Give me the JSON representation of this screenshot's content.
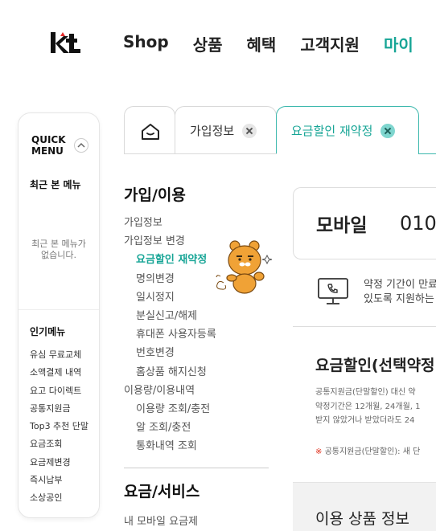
{
  "header": {
    "logo_text": "kt",
    "nav": [
      {
        "label": "Shop",
        "active": false
      },
      {
        "label": "상품",
        "active": false
      },
      {
        "label": "혜택",
        "active": false
      },
      {
        "label": "고객지원",
        "active": false
      },
      {
        "label": "마이",
        "active": true
      }
    ]
  },
  "quick_menu": {
    "title": "QUICK\nMENU",
    "recent_title": "최근 본 메뉴",
    "recent_empty": "최근 본 메뉴가\n없습니다.",
    "popular_title": "인기메뉴",
    "popular_items": [
      "유심 무료교체",
      "소액결제 내역",
      "요고 다이렉트",
      "공통지원금",
      "Top3 추천 단말",
      "요금조회",
      "요금제변경",
      "즉시납부",
      "소상공인"
    ]
  },
  "tabs": [
    {
      "label": "가입정보"
    },
    {
      "label": "요금할인 재약정",
      "active": true
    }
  ],
  "lnb": {
    "section1_title": "가입/이용",
    "items": [
      {
        "label": "가입정보",
        "level": 1
      },
      {
        "label": "가입정보 변경",
        "level": 1
      },
      {
        "label": "요금할인 재약정",
        "level": 2,
        "active": true
      },
      {
        "label": "명의변경",
        "level": 2
      },
      {
        "label": "일시정지",
        "level": 2
      },
      {
        "label": "분실신고/해제",
        "level": 2
      },
      {
        "label": "휴대폰 사용자등록",
        "level": 2
      },
      {
        "label": "번호변경",
        "level": 2
      },
      {
        "label": "홈상품 해지신청",
        "level": 2
      },
      {
        "label": "이용량/이용내역",
        "level": 1
      },
      {
        "label": "이용량 조회/충전",
        "level": 2
      },
      {
        "label": "알 조회/충전",
        "level": 2
      },
      {
        "label": "통화내역 조회",
        "level": 2
      }
    ],
    "section2_title": "요금/서비스",
    "section2_first_item": "내 모바일 요금제"
  },
  "main": {
    "mobile_title": "모바일",
    "mobile_number": "010",
    "notice_text": "약정 기간이 만료\n있도록 지원하는",
    "section_title": "요금할인(선택약정",
    "section_desc": "공통지원금(단말할인) 대신 약\n약정기간은 12개월, 24개월, 1\n받지 않았거나 받았더라도 24",
    "section_note_mark": "※",
    "section_note": " 공통지원금(단말할인): 새 단",
    "usage_title": "이용 상품 정보"
  },
  "colors": {
    "accent": "#17a596",
    "tab_active_border": "#3cb8ad",
    "note_mark": "#e0321e"
  },
  "icons": {
    "logo": "kt-logo",
    "home_tab": "home-icon",
    "tab_close": "close-icon",
    "quick_toggle": "chevron-up-icon",
    "notice": "monitor-phone-icon",
    "character": "ryan-character"
  }
}
